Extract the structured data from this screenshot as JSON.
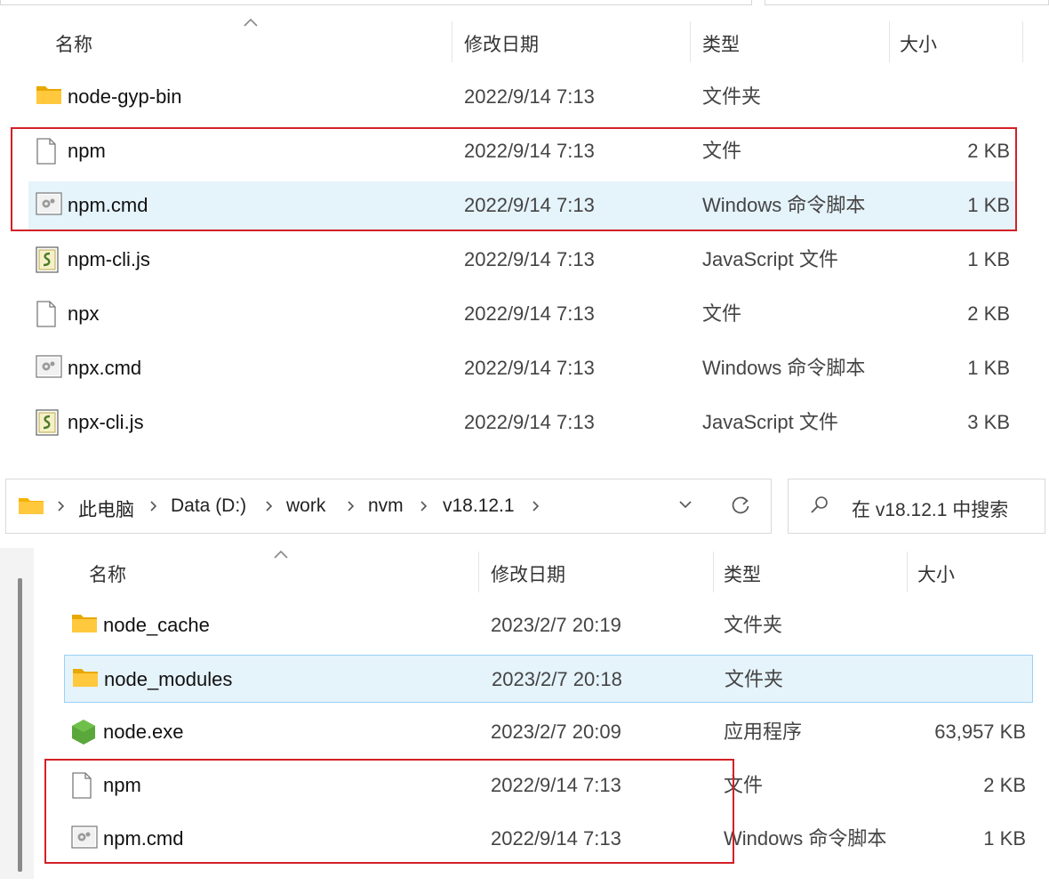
{
  "columns": {
    "name": "名称",
    "date": "修改日期",
    "type": "类型",
    "size": "大小"
  },
  "top_rows": [
    {
      "icon": "folder-icon",
      "name": "node-gyp-bin",
      "date": "2022/9/14 7:13",
      "type": "文件夹",
      "size": ""
    },
    {
      "icon": "file-icon",
      "name": "npm",
      "date": "2022/9/14 7:13",
      "type": "文件",
      "size": "2 KB"
    },
    {
      "icon": "cmd-file-icon",
      "name": "npm.cmd",
      "date": "2022/9/14 7:13",
      "type": "Windows 命令脚本",
      "size": "1 KB"
    },
    {
      "icon": "js-file-icon",
      "name": "npm-cli.js",
      "date": "2022/9/14 7:13",
      "type": "JavaScript 文件",
      "size": "1 KB"
    },
    {
      "icon": "file-icon",
      "name": "npx",
      "date": "2022/9/14 7:13",
      "type": "文件",
      "size": "2 KB"
    },
    {
      "icon": "cmd-file-icon",
      "name": "npx.cmd",
      "date": "2022/9/14 7:13",
      "type": "Windows 命令脚本",
      "size": "1 KB"
    },
    {
      "icon": "js-file-icon",
      "name": "npx-cli.js",
      "date": "2022/9/14 7:13",
      "type": "JavaScript 文件",
      "size": "3 KB"
    }
  ],
  "address_bar": {
    "crumbs": [
      "此电脑",
      "Data (D:)",
      "work",
      "nvm",
      "v18.12.1"
    ],
    "search_placeholder": "在 v18.12.1 中搜索"
  },
  "bottom_rows": [
    {
      "icon": "folder-icon",
      "name": "node_cache",
      "date": "2023/2/7 20:19",
      "type": "文件夹",
      "size": ""
    },
    {
      "icon": "folder-icon",
      "name": "node_modules",
      "date": "2023/2/7 20:18",
      "type": "文件夹",
      "size": ""
    },
    {
      "icon": "nodejs-icon",
      "name": "node.exe",
      "date": "2023/2/7 20:09",
      "type": "应用程序",
      "size": "63,957 KB"
    },
    {
      "icon": "file-icon",
      "name": "npm",
      "date": "2022/9/14 7:13",
      "type": "文件",
      "size": "2 KB"
    },
    {
      "icon": "cmd-file-icon",
      "name": "npm.cmd",
      "date": "2022/9/14 7:13",
      "type": "Windows 命令脚本",
      "size": "1 KB"
    }
  ]
}
